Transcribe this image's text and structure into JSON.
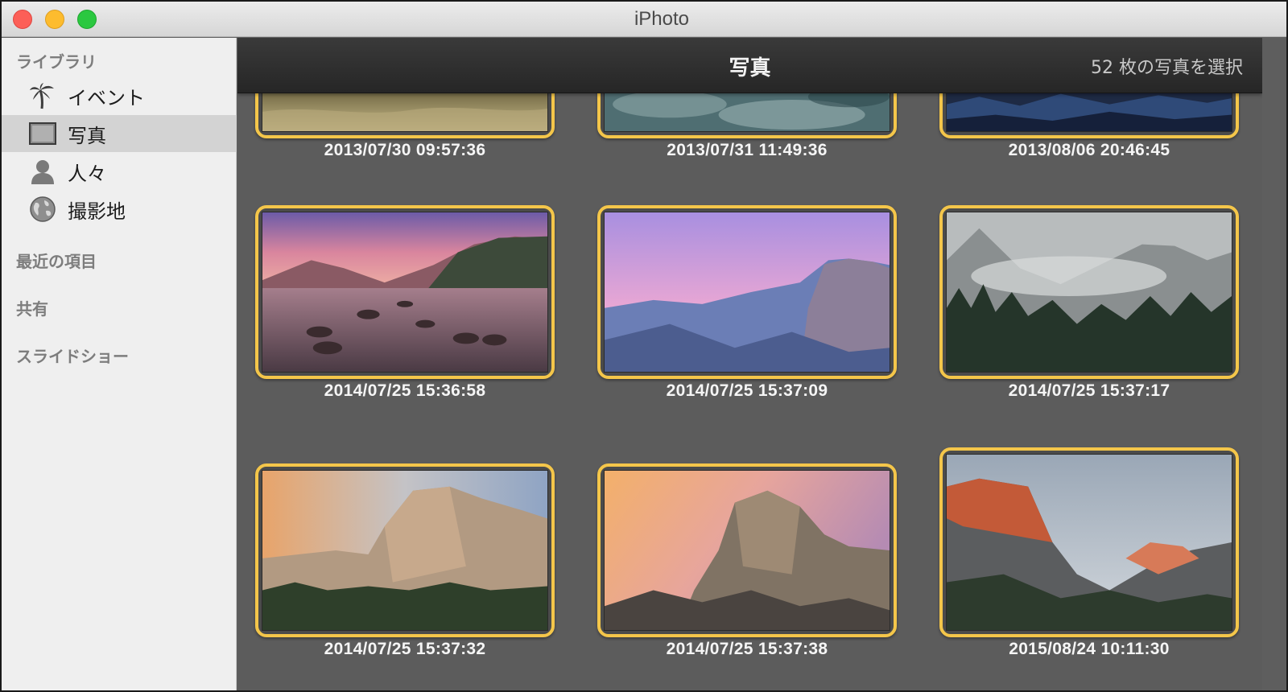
{
  "window": {
    "title": "iPhoto"
  },
  "sidebar": {
    "library_header": "ライブラリ",
    "items": [
      {
        "label": "イベント",
        "icon": "palm-tree-icon"
      },
      {
        "label": "写真",
        "icon": "photo-frame-icon",
        "selected": true
      },
      {
        "label": "人々",
        "icon": "person-icon"
      },
      {
        "label": "撮影地",
        "icon": "globe-icon"
      }
    ],
    "recent_header": "最近の項目",
    "shared_header": "共有",
    "slideshow_header": "スライドショー"
  },
  "toolbar": {
    "title": "写真",
    "selection_count": "52 枚の写真を選択"
  },
  "photos": [
    {
      "date": "2013/07/30 09:57:36"
    },
    {
      "date": "2013/07/31 11:49:36"
    },
    {
      "date": "2013/08/06 20:46:45"
    },
    {
      "date": "2014/07/25 15:36:58"
    },
    {
      "date": "2014/07/25 15:37:09"
    },
    {
      "date": "2014/07/25 15:37:17"
    },
    {
      "date": "2014/07/25 15:37:32"
    },
    {
      "date": "2014/07/25 15:37:38"
    },
    {
      "date": "2015/08/24 10:11:30"
    }
  ],
  "colors": {
    "selection_border": "#f4c64a",
    "content_background": "#5c5c5c",
    "sidebar_background": "#efefef"
  }
}
